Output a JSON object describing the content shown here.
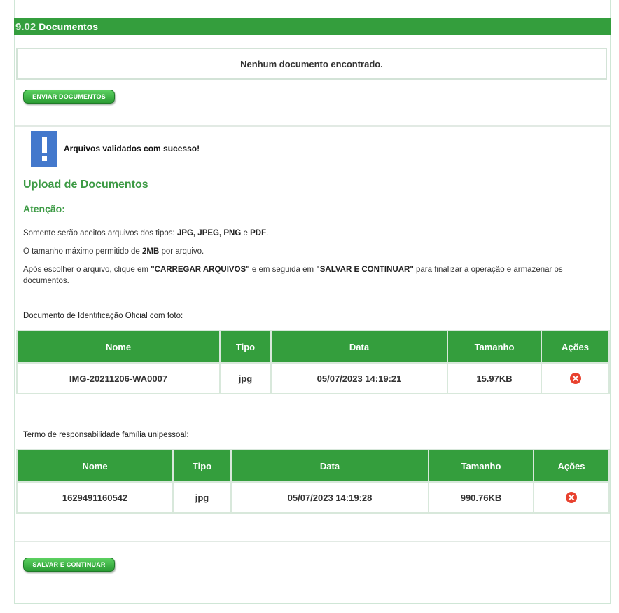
{
  "section": {
    "number": "9.02",
    "title": "Documentos"
  },
  "empty_message": "Nenhum documento encontrado.",
  "send_button": "ENVIAR DOCUMENTOS",
  "alert": {
    "icon": "exclamation-icon",
    "message": "Arquivos validados com sucesso!"
  },
  "upload": {
    "title": "Upload de Documentos",
    "attention": "Atenção:",
    "line1_prefix": "Somente serão aceitos arquivos dos tipos: ",
    "line1_types": "JPG, JPEG, PNG",
    "line1_and": " e ",
    "line1_pdf": "PDF",
    "line1_suffix": ".",
    "line2_prefix": "O tamanho máximo permitido de ",
    "line2_size": "2MB",
    "line2_suffix": " por arquivo.",
    "line3_prefix": "Após escolher o arquivo, clique em ",
    "line3_btn1": "\"CARREGAR ARQUIVOS\"",
    "line3_mid": " e em seguida em ",
    "line3_btn2": "\"SALVAR E CONTINUAR\"",
    "line3_suffix": " para finalizar a operação e armazenar os documentos."
  },
  "tables": [
    {
      "label": "Documento de Identificação Oficial com foto:",
      "headers": [
        "Nome",
        "Tipo",
        "Data",
        "Tamanho",
        "Ações"
      ],
      "rows": [
        {
          "nome": "IMG-20211206-WA0007",
          "tipo": "jpg",
          "data": "05/07/2023 14:19:21",
          "tamanho": "15.97KB",
          "acao_icon": "delete-icon"
        }
      ]
    },
    {
      "label": "Termo de responsabilidade família unipessoal:",
      "headers": [
        "Nome",
        "Tipo",
        "Data",
        "Tamanho",
        "Ações"
      ],
      "rows": [
        {
          "nome": "1629491160542",
          "tipo": "jpg",
          "data": "05/07/2023 14:19:28",
          "tamanho": "990.76KB",
          "acao_icon": "delete-icon"
        }
      ]
    }
  ],
  "save_button": "SALVAR E CONTINUAR",
  "colors": {
    "primary_green": "#349e3d",
    "title_green": "#3c9a44",
    "alert_blue": "#4378cc",
    "delete_red": "#e8412e"
  }
}
